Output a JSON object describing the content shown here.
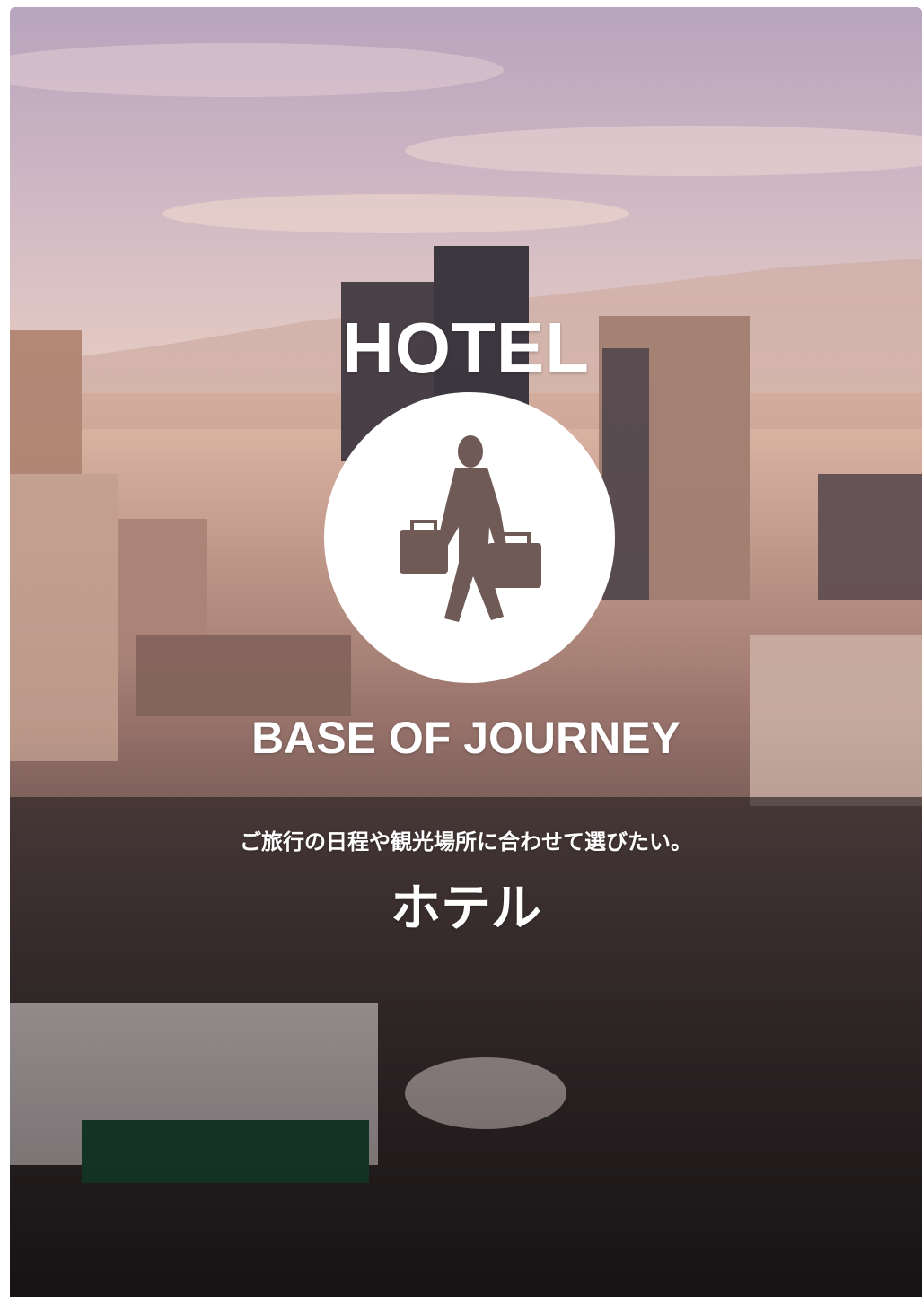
{
  "hero": {
    "title": "HOTEL",
    "emblem_icon": "traveler-with-luggage-icon",
    "subtitle": "BASE OF JOURNEY",
    "tagline": "ご旅行の日程や観光場所に合わせて選びたい。",
    "heading": "ホテル"
  },
  "colors": {
    "text": "#ffffff",
    "sky_top": "#c9b2c4",
    "sky_bottom": "#f3d6c0",
    "city_dark": "#2a2528"
  }
}
